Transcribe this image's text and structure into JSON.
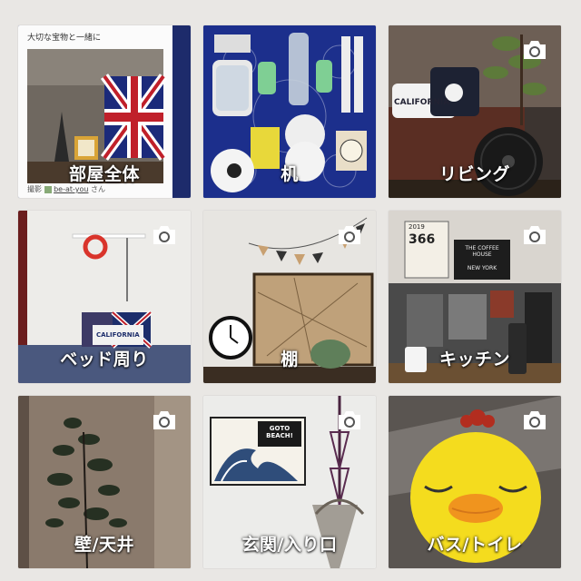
{
  "categories": [
    {
      "label": "部屋全体",
      "camera": false,
      "card": {
        "title": "大切な宝物と一緒に",
        "credit_prefix": "撮影",
        "user": "be-at-you",
        "suffix": "さん"
      }
    },
    {
      "label": "机",
      "camera": false
    },
    {
      "label": "リビング",
      "camera": true
    },
    {
      "label": "ベッド周り",
      "camera": true
    },
    {
      "label": "棚",
      "camera": true
    },
    {
      "label": "キッチン",
      "camera": true
    },
    {
      "label": "壁/天井",
      "camera": true
    },
    {
      "label": "玄関/入り口",
      "camera": true
    },
    {
      "label": "バス/トイレ",
      "camera": true
    }
  ],
  "photo_text": {
    "pillow": "CALIFORNIA",
    "pillow_bed": "CALIFORNIA",
    "poster": "GOTO BEACH!",
    "calendar_year": "2019",
    "calendar_days": "366",
    "coffee_sign": "THE COFFEE HOUSE",
    "coffee_sub": "NEW YORK"
  },
  "icon": "camera-icon"
}
